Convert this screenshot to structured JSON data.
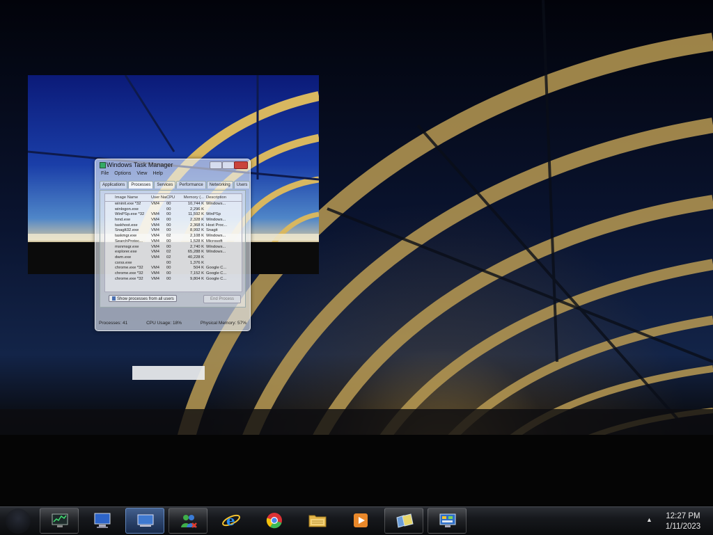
{
  "taskmgr": {
    "title": "Windows Task Manager",
    "menu": [
      "File",
      "Options",
      "View",
      "Help"
    ],
    "tabs": [
      "Applications",
      "Processes",
      "Services",
      "Performance",
      "Networking",
      "Users"
    ],
    "active_tab": "Processes",
    "columns": [
      "Image Name",
      "User Name",
      "CPU",
      "Memory (...",
      "Description"
    ],
    "rows": [
      [
        "wininit.exe *32",
        "VM4",
        "00",
        "10,744 K",
        "Windows..."
      ],
      [
        "winlogon.exe",
        "",
        "00",
        "2,296 K",
        ""
      ],
      [
        "WinPSp.exe *32",
        "VM4",
        "00",
        "11,592 K",
        "WinPSp"
      ],
      [
        "hmd.exe",
        "VM4",
        "00",
        "2,328 K",
        "Windows..."
      ],
      [
        "taskhost.exe",
        "VM4",
        "00",
        "2,368 K",
        "Host Proc..."
      ],
      [
        "SnagIt32.exe",
        "VM4",
        "00",
        "8,992 K",
        "Snagit"
      ],
      [
        "taskmgr.exe",
        "VM4",
        "02",
        "2,108 K",
        "Windows..."
      ],
      [
        "SearchProtoc...",
        "VM4",
        "00",
        "1,528 K",
        "Microsoft"
      ],
      [
        "msnmsgr.exe",
        "VM4",
        "00",
        "2,740 K",
        "Windows..."
      ],
      [
        "explorer.exe",
        "VM4",
        "02",
        "65,288 K",
        "Windows..."
      ],
      [
        "dwm.exe",
        "VM4",
        "02",
        "40,228 K",
        ""
      ],
      [
        "csrss.exe",
        "",
        "00",
        "1,376 K",
        ""
      ],
      [
        "chrome.exe *32",
        "VM4",
        "00",
        "504 K",
        "Google C..."
      ],
      [
        "chrome.exe *32",
        "VM4",
        "00",
        "7,152 K",
        "Google C..."
      ],
      [
        "chrome.exe *32",
        "VM4",
        "00",
        "9,804 K",
        "Google C..."
      ]
    ],
    "show_all_label": "Show processes from all users",
    "end_process_label": "End Process",
    "status": {
      "processes": "Processes: 41",
      "cpu": "CPU Usage: 18%",
      "memory": "Physical Memory: 57%"
    }
  },
  "taskbar": {
    "items": [
      {
        "name": "taskbar-item-1",
        "icon": "monitor-chart-icon",
        "state": "pinned"
      },
      {
        "name": "taskbar-item-2",
        "icon": "computer-icon",
        "state": "normal"
      },
      {
        "name": "taskbar-item-3",
        "icon": "desktop-icon",
        "state": "active"
      },
      {
        "name": "taskbar-item-4",
        "icon": "messenger-icon",
        "state": "pinned"
      },
      {
        "name": "taskbar-item-5",
        "icon": "internet-explorer-icon",
        "state": "normal"
      },
      {
        "name": "taskbar-item-6",
        "icon": "chrome-icon",
        "state": "normal"
      },
      {
        "name": "taskbar-item-7",
        "icon": "folder-icon",
        "state": "normal"
      },
      {
        "name": "taskbar-item-8",
        "icon": "media-player-icon",
        "state": "normal"
      },
      {
        "name": "taskbar-item-9",
        "icon": "windows-flip-icon",
        "state": "pinned"
      },
      {
        "name": "taskbar-item-10",
        "icon": "control-panel-icon",
        "state": "pinned"
      }
    ],
    "clock": {
      "time": "12:27 PM",
      "date": "1/11/2023"
    }
  },
  "colors": {
    "accent": "#3a74c8",
    "taskbar": "#16181c",
    "close": "#c9433b"
  }
}
